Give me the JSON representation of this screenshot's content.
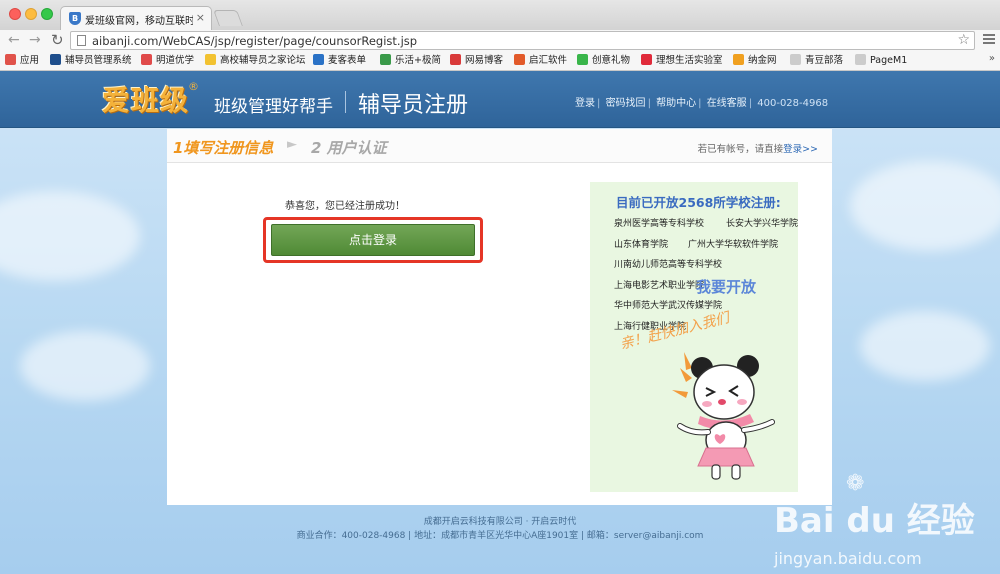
{
  "browser": {
    "tab_title": "爱班级官网，移动互联时代教",
    "tab_close": "×",
    "url": "aibanji.com/WebCAS/jsp/register/page/counsorRegist.jsp",
    "bookmarks": [
      {
        "label": "应用",
        "icon": "apps-grid-icon",
        "color": "#e0524a"
      },
      {
        "label": "辅导员管理系统",
        "icon": "bookmark-site-icon",
        "color": "#1e4e8c"
      },
      {
        "label": "明道优学",
        "icon": "bookmark-site-icon",
        "color": "#e04a4a"
      },
      {
        "label": "高校辅导员之家论坛",
        "icon": "bookmark-site-icon",
        "color": "#f2c231"
      },
      {
        "label": "麦客表单",
        "icon": "bookmark-site-icon",
        "color": "#2a72c6"
      },
      {
        "label": "乐活+极简",
        "icon": "bookmark-site-icon",
        "color": "#3a9a4a"
      },
      {
        "label": "网易博客",
        "icon": "bookmark-site-icon",
        "color": "#d93a3a"
      },
      {
        "label": "启汇软件",
        "icon": "bookmark-site-icon",
        "color": "#e25a2a"
      },
      {
        "label": "创意礼物",
        "icon": "bookmark-site-icon",
        "color": "#39b54a"
      },
      {
        "label": "理想生活实验室",
        "icon": "bookmark-site-icon",
        "color": "#e02a3a"
      },
      {
        "label": "纳金网",
        "icon": "bookmark-site-icon",
        "color": "#f0a020"
      },
      {
        "label": "青豆部落",
        "icon": "bookmark-page-icon",
        "color": "#cccccc"
      },
      {
        "label": "PageM1",
        "icon": "bookmark-page-icon",
        "color": "#cccccc"
      }
    ],
    "bookmarks_more": "»"
  },
  "header": {
    "logo": "爱班级",
    "logo_mark": "®",
    "slogan": "班级管理好帮手",
    "title": "辅导员注册",
    "links": [
      "登录",
      "密码找回",
      "帮助中心",
      "在线客服"
    ],
    "phone": "400-028-4968"
  },
  "steps": {
    "step1": "1填写注册信息",
    "arrow": "►",
    "step2": "2  用户认证",
    "hint": "若已有帐号，请直接",
    "hint_link": "登录>>"
  },
  "main": {
    "success_message": "恭喜您，您已经注册成功！",
    "login_button": "点击登录"
  },
  "promo": {
    "title": "目前已开放2568所学校注册:",
    "schools": [
      "泉州医学高等专科学校",
      "长安大学兴华学院",
      "山东体育学院",
      "广州大学华软软件学院",
      "川南幼儿师范高等专科学校",
      "上海电影艺术职业学院",
      "华中师范大学武汉传媒学院",
      "上海行健职业学院"
    ],
    "want_open": "我要开放",
    "join_us": "亲！赶快加入我们"
  },
  "footer": {
    "line1": "成都开启云科技有限公司 · 开启云时代",
    "line2": "商业合作：400-028-4968  |  地址：成都市青羊区光华中心A座1901室 | 邮箱：server@aibanji.com"
  },
  "watermark": {
    "brand": "Bai du 经验",
    "url": "jingyan.baidu.com"
  }
}
